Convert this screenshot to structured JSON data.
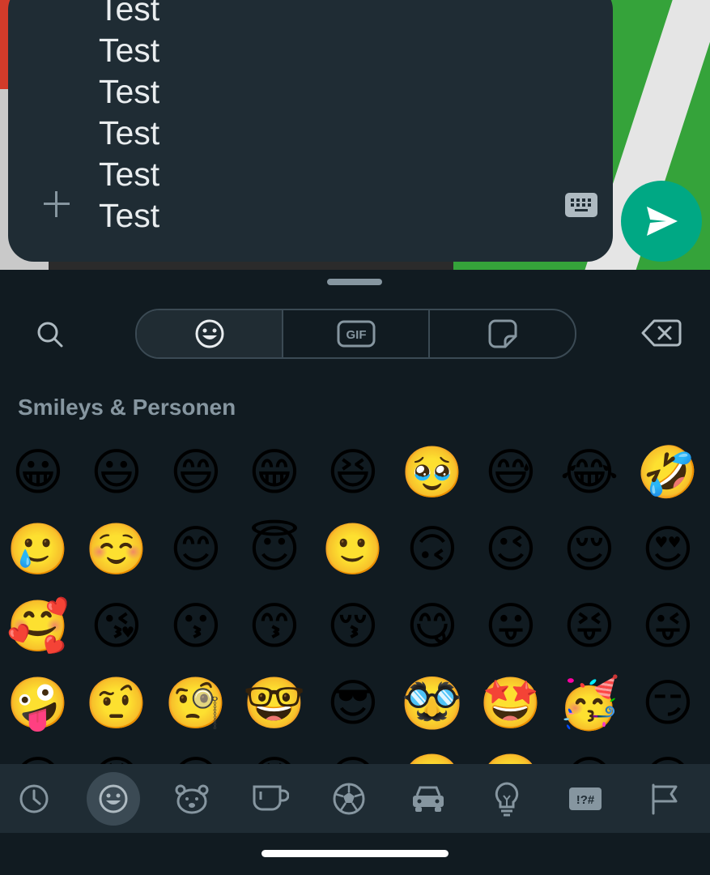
{
  "composer": {
    "message_lines": [
      "Test",
      "Test",
      "Test",
      "Test",
      "Test",
      "Test"
    ],
    "plus_icon": "plus-icon",
    "keyboard_icon": "keyboard-icon",
    "send_icon": "send-icon"
  },
  "panel": {
    "search_icon": "search-icon",
    "tabs": [
      {
        "name": "emoji",
        "icon": "smiley-icon",
        "active": true
      },
      {
        "name": "gif",
        "label": "GIF",
        "icon": "gif-icon",
        "active": false
      },
      {
        "name": "sticker",
        "icon": "sticker-icon",
        "active": false
      }
    ],
    "backspace_icon": "backspace-icon",
    "section_title": "Smileys & Personen",
    "emojis": [
      "😀",
      "😃",
      "😄",
      "😁",
      "😆",
      "🥹",
      "😅",
      "😂",
      "🤣",
      "🥲",
      "☺️",
      "😊",
      "😇",
      "🙂",
      "🙃",
      "😉",
      "😌",
      "😍",
      "🥰",
      "😘",
      "😗",
      "😙",
      "😚",
      "😋",
      "😛",
      "😝",
      "😜",
      "🤪",
      "🤨",
      "🧐",
      "🤓",
      "😎",
      "🥸",
      "🤩",
      "🥳",
      "😏",
      "😒",
      "😞",
      "😔",
      "😟",
      "😕",
      "🙁",
      "☹️",
      "😣",
      "😖"
    ]
  },
  "categories": [
    {
      "name": "recent",
      "icon": "clock-icon",
      "active": false
    },
    {
      "name": "smileys",
      "icon": "smiley-icon",
      "active": true
    },
    {
      "name": "animals",
      "icon": "bear-icon",
      "active": false
    },
    {
      "name": "food",
      "icon": "cup-icon",
      "active": false
    },
    {
      "name": "activities",
      "icon": "ball-icon",
      "active": false
    },
    {
      "name": "travel",
      "icon": "car-icon",
      "active": false
    },
    {
      "name": "objects",
      "icon": "bulb-icon",
      "active": false
    },
    {
      "name": "symbols",
      "label": "!?#",
      "icon": "symbols-icon",
      "active": false
    },
    {
      "name": "flags",
      "icon": "flag-icon",
      "active": false
    }
  ],
  "colors": {
    "panel_bg": "#111b21",
    "bubble_bg": "#1f2c34",
    "icon_gray": "#8696a0",
    "send_green": "#00a884",
    "text": "#e9edef"
  }
}
